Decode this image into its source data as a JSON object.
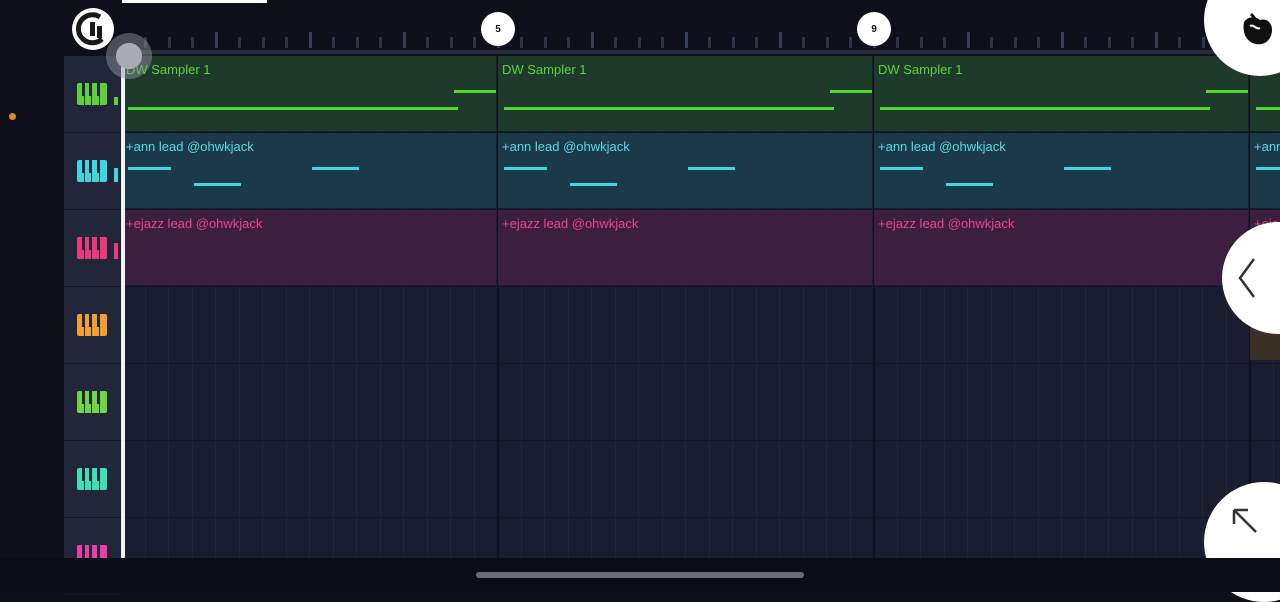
{
  "timeline": {
    "markers": [
      "5",
      "9"
    ]
  },
  "colors": {
    "background": "#0e0f1a",
    "grid": "#1a1d30",
    "track_header": "#22263a",
    "playhead": "#f2f2f2",
    "accent_dot": "#e08a2b"
  },
  "tracks": [
    {
      "icon": "piano-icon",
      "color": "#5ed13a"
    },
    {
      "icon": "piano-icon",
      "color": "#3fd6e0"
    },
    {
      "icon": "piano-icon",
      "color": "#e93b7c"
    },
    {
      "icon": "piano-icon",
      "color": "#f0a030"
    },
    {
      "icon": "piano-icon",
      "color": "#6fd63b"
    },
    {
      "icon": "piano-icon",
      "color": "#3ee0b5"
    },
    {
      "icon": "piano-icon",
      "color": "#e83ea6"
    }
  ],
  "clips": {
    "row0": {
      "label": "DW Sampler 1",
      "bg": "#1e3a2b",
      "text_color": "#5ed13a",
      "note_color": "#4fd92f"
    },
    "row1": {
      "label": "+ann lead @ohwkjack",
      "bg": "#1a3a4a",
      "text_color": "#56dce8",
      "note_color": "#3fd6e0"
    },
    "row2": {
      "label": "+ejazz lead @ohwkjack",
      "bg": "#3c1f3e",
      "text_color": "#e8458a",
      "note_color": "#e93b7c"
    }
  },
  "icons": {
    "logo": "fl-studio-logo-icon",
    "fruit": "fl-fruit-logo-icon",
    "collapse": "chevron-left-icon",
    "expand": "arrow-up-left-icon"
  }
}
